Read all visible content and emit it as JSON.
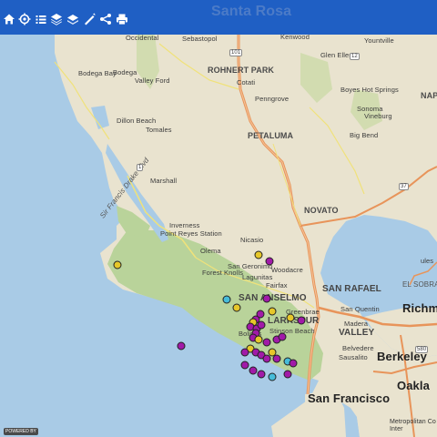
{
  "header": {
    "faded_text": "Santa Rosa"
  },
  "toolbar": {
    "icons": [
      "home-icon",
      "locate-icon",
      "list-icon",
      "layers-icon",
      "basemap-icon",
      "measure-icon",
      "share-icon",
      "print-icon"
    ]
  },
  "colors": {
    "toolbar": "#1f5fc4",
    "water": "#a9cbe6",
    "land": "#e9e3cf",
    "park": "#b9d39a",
    "highway": "#e8945a",
    "marker_purple": "#a11aa8",
    "marker_yellow": "#e6c72a",
    "marker_teal": "#46bcd9"
  },
  "labels": {
    "occidental": "Occidental",
    "sebastopol": "Sebastopol",
    "kenwood": "Kenwood",
    "yountville": "Yountville",
    "glen_ellen": "Glen Ellen",
    "rohnert_park": "ROHNERT PARK",
    "bodega_bay": "Bodega Bay",
    "bodega": "Bodega",
    "valley_ford": "Valley Ford",
    "cotati": "Cotati",
    "penngrove": "Penngrove",
    "boyes_hot_springs": "Boyes Hot Springs",
    "sonoma": "Sonoma",
    "vineburg": "Vineburg",
    "napa": "NAP",
    "dillon_beach": "Dillon Beach",
    "tomales": "Tomales",
    "petaluma": "PETALUMA",
    "big_bend": "Big Bend",
    "marshall": "Marshall",
    "novato": "NOVATO",
    "sir_francis_drake_blvd": "Sir Francis Drake Blvd",
    "inverness": "Inverness",
    "point_reyes_station": "Point Reyes Station",
    "olema": "Olema",
    "nicasio": "Nicasio",
    "san_geronimo": "San Geronimo",
    "forest_knolls": "Forest Knolls",
    "lagunitas": "Lagunitas",
    "woodacre": "Woodacre",
    "fairfax": "Fairfax",
    "san_rafael": "SAN RAFAEL",
    "san_anselmo": "SAN ANSELMO",
    "larkspur": "LARKSPUR",
    "san_quentin": "San Quentin",
    "greenbrae": "Greenbrae",
    "mill_valley": "VALLEY",
    "madera": "Madera",
    "bolinas": "Bolinas",
    "stinson_beach": "Stinson Beach",
    "belvedere": "Belvedere",
    "sausalito": "Sausalito",
    "el_sobrante": "EL SOBRA",
    "richmond": "Richm",
    "berkeley": "Berkeley",
    "oakland": "Oakla",
    "san_francisco": "San Francisco",
    "hercules": "ules",
    "metro_credit_1": "Metropolitan Co",
    "metro_credit_2": "Inter",
    "powered_by": "POWERED BY",
    "route_101": "101",
    "route_1": "1",
    "route_37": "37",
    "route_12": "12",
    "route_580": "580"
  },
  "markers": [
    {
      "color": "yellow",
      "lon": -122.535,
      "lat": 38.06
    },
    {
      "color": "purple",
      "lon": -122.515,
      "lat": 38.05
    },
    {
      "color": "purple",
      "lon": -122.52,
      "lat": 37.99
    },
    {
      "color": "yellow",
      "lon": -122.575,
      "lat": 37.975
    },
    {
      "color": "yellow",
      "lon": -122.51,
      "lat": 37.97
    },
    {
      "color": "teal",
      "lon": -122.595,
      "lat": 37.988
    },
    {
      "color": "yellow",
      "lon": -122.8,
      "lat": 38.044
    },
    {
      "color": "purple",
      "lon": -122.532,
      "lat": 37.965
    },
    {
      "color": "purple",
      "lon": -122.54,
      "lat": 37.957
    },
    {
      "color": "yellow",
      "lon": -122.545,
      "lat": 37.952
    },
    {
      "color": "purple",
      "lon": -122.55,
      "lat": 37.945
    },
    {
      "color": "purple",
      "lon": -122.538,
      "lat": 37.942
    },
    {
      "color": "purple",
      "lon": -122.53,
      "lat": 37.948
    },
    {
      "color": "yellow",
      "lon": -122.475,
      "lat": 37.96
    },
    {
      "color": "purple",
      "lon": -122.455,
      "lat": 37.955
    },
    {
      "color": "purple",
      "lon": -122.54,
      "lat": 37.935
    },
    {
      "color": "purple",
      "lon": -122.545,
      "lat": 37.928
    },
    {
      "color": "yellow",
      "lon": -122.535,
      "lat": 37.925
    },
    {
      "color": "purple",
      "lon": -122.52,
      "lat": 37.92
    },
    {
      "color": "purple",
      "lon": -122.5,
      "lat": 37.925
    },
    {
      "color": "purple",
      "lon": -122.49,
      "lat": 37.93
    },
    {
      "color": "yellow",
      "lon": -122.55,
      "lat": 37.91
    },
    {
      "color": "purple",
      "lon": -122.56,
      "lat": 37.905
    },
    {
      "color": "purple",
      "lon": -122.54,
      "lat": 37.905
    },
    {
      "color": "purple",
      "lon": -122.53,
      "lat": 37.9
    },
    {
      "color": "purple",
      "lon": -122.52,
      "lat": 37.895
    },
    {
      "color": "yellow",
      "lon": -122.51,
      "lat": 37.905
    },
    {
      "color": "purple",
      "lon": -122.5,
      "lat": 37.895
    },
    {
      "color": "teal",
      "lon": -122.48,
      "lat": 37.89
    },
    {
      "color": "purple",
      "lon": -122.47,
      "lat": 37.888
    },
    {
      "color": "purple",
      "lon": -122.56,
      "lat": 37.885
    },
    {
      "color": "purple",
      "lon": -122.545,
      "lat": 37.875
    },
    {
      "color": "purple",
      "lon": -122.53,
      "lat": 37.87
    },
    {
      "color": "teal",
      "lon": -122.51,
      "lat": 37.865
    },
    {
      "color": "purple",
      "lon": -122.48,
      "lat": 37.87
    },
    {
      "color": "purple",
      "lon": -122.68,
      "lat": 37.915
    }
  ]
}
